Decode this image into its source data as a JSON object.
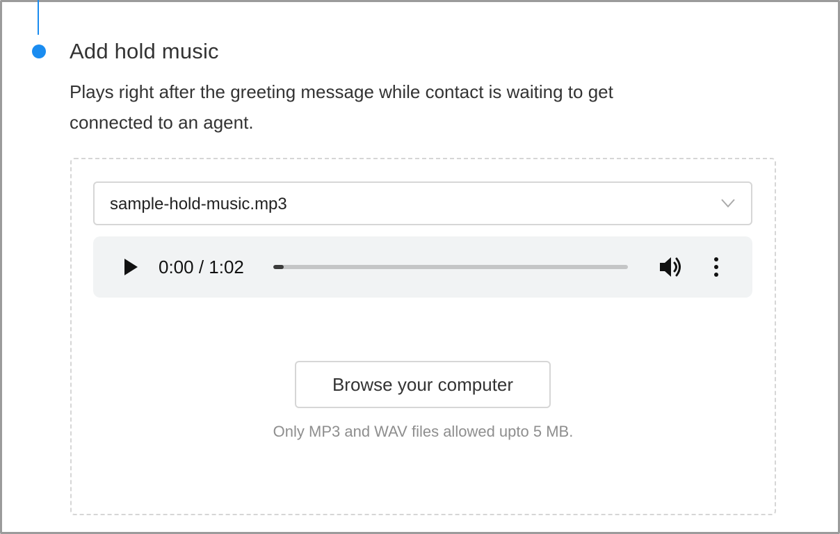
{
  "step": {
    "title": "Add hold music",
    "description": "Plays right after the greeting message while contact is waiting to get connected to an agent."
  },
  "file_select": {
    "selected": "sample-hold-music.mp3",
    "icon": "chevron-down-icon"
  },
  "player": {
    "time_display": "0:00 / 1:02",
    "progress_fraction": 0.03,
    "icons": [
      "play-icon",
      "volume-icon",
      "more-vertical-icon"
    ]
  },
  "upload": {
    "browse_label": "Browse your computer",
    "hint": "Only MP3 and WAV files allowed upto 5 MB."
  },
  "colors": {
    "accent": "#1a8cf0",
    "border": "#d6d6d6",
    "player_bg": "#f1f3f4",
    "hint_text": "#8e8e8e"
  }
}
